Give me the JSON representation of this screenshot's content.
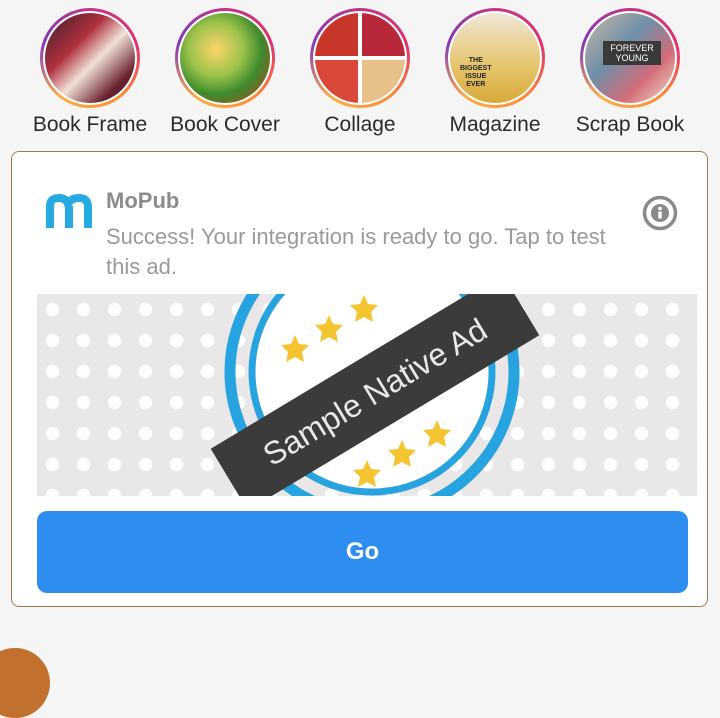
{
  "stories": [
    {
      "label": "Book Frame"
    },
    {
      "label": "Book Cover"
    },
    {
      "label": "Collage"
    },
    {
      "label": "Magazine"
    },
    {
      "label": "Scrap Book"
    }
  ],
  "ad": {
    "title": "MoPub",
    "text": "Success! Your integration is ready to go. Tap to test this ad.",
    "image_banner": "Sample Native Ad",
    "cta_label": "Go",
    "logo_icon": "mopub-logo-icon",
    "info_icon": "info-icon",
    "accent_color": "#2d8ef0"
  },
  "magazine_thumb_text": [
    "THE",
    "BIGGEST",
    "ISSUE",
    "EVER"
  ],
  "scrap_thumb_text": "FOREVER YOUNG"
}
